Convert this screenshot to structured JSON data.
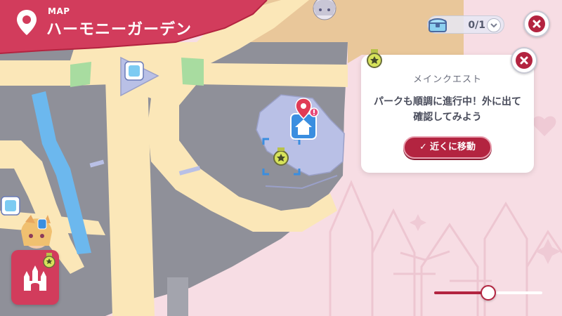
{
  "header": {
    "subtitle": "MAP",
    "title": "ハーモニーガーデン",
    "location_icon": "map-pin-icon"
  },
  "chest_counter": {
    "count": "0/1",
    "icon": "treasure-chest-icon"
  },
  "quest": {
    "type": "メインクエスト",
    "description_line1": "パークも順調に進行中！外に出て",
    "description_line2": "確認してみよう",
    "move_button_label": "近くに移動"
  },
  "zoom": {
    "level": 0.5
  },
  "colors": {
    "accent": "#b32440",
    "header": "#d23c5c",
    "ground": "#8f9099",
    "path": "#fbe7b8",
    "building": "#b9c0e6",
    "water": "#6cb8ee",
    "grass": "#a8dca0",
    "pink_bg": "#f7dde4"
  }
}
